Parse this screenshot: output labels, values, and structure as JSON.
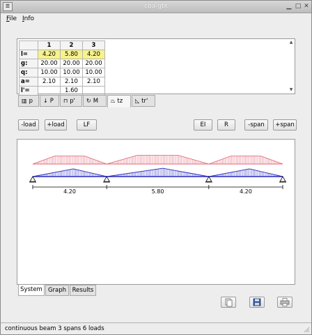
{
  "window": {
    "title": "cba-gtk"
  },
  "menu": {
    "file": "File",
    "info": "Info",
    "file_mnemonic": "F",
    "file_rest": "ile",
    "info_mnemonic": "I",
    "info_rest": "nfo"
  },
  "table": {
    "columns": [
      "1",
      "2",
      "3"
    ],
    "rows": [
      {
        "label": "l=",
        "values": [
          "4.20",
          "5.80",
          "4.20"
        ],
        "highlight": true
      },
      {
        "label": "g:",
        "values": [
          "20.00",
          "20.00",
          "20.00"
        ],
        "highlight": false
      },
      {
        "label": "q:",
        "values": [
          "10.00",
          "10.00",
          "10.00"
        ],
        "highlight": false
      },
      {
        "label": "a=",
        "values": [
          "2.10",
          "2.10",
          "2.10"
        ],
        "highlight": false
      },
      {
        "label": "l'=",
        "values": [
          "",
          "1.60",
          ""
        ],
        "highlight": false
      }
    ]
  },
  "load_tabs": [
    {
      "label": "p",
      "icon": "uniform-load-icon"
    },
    {
      "label": "P",
      "icon": "point-load-icon"
    },
    {
      "label": "p'",
      "icon": "partial-load-icon"
    },
    {
      "label": "M",
      "icon": "moment-icon"
    },
    {
      "label": "tz",
      "icon": "trapezoid-load-icon",
      "active": true
    },
    {
      "label": "tr'",
      "icon": "triangle-load-icon"
    }
  ],
  "toolbar": {
    "minus_load": "-load",
    "plus_load": "+load",
    "lf": "LF",
    "ei": "EI",
    "r": "R",
    "minus_span": "-span",
    "plus_span": "+span"
  },
  "diagram": {
    "span_labels": [
      "4.20",
      "5.80",
      "4.20"
    ],
    "spans": [
      4.2,
      5.8,
      4.2
    ],
    "colors": {
      "upper": "#e06070",
      "lower": "#2a2ac0",
      "axis": "#000000"
    }
  },
  "bottom_tabs": {
    "system": "System",
    "graph": "Graph",
    "results": "Results"
  },
  "actions": {
    "copy_icon": "copy-icon",
    "save_icon": "save-icon",
    "print_icon": "print-icon"
  },
  "status": {
    "text": "continuous beam 3 spans 6 loads"
  }
}
